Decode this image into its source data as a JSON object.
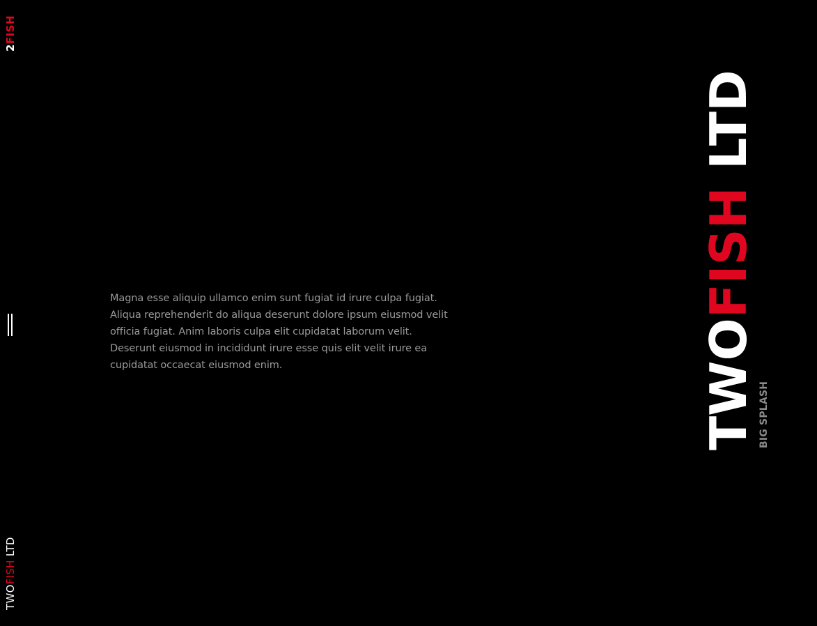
{
  "logo_small": {
    "part1": "2",
    "part2": "FISH"
  },
  "menu": {
    "label": ""
  },
  "brand_bottom": {
    "part1": "TWO",
    "part2": "FISH",
    "part3": " LTD"
  },
  "intro_text": "Magna esse aliquip ullamco enim sunt fugiat id irure culpa fugiat. Aliqua reprehenderit do aliqua deserunt dolore ipsum eiusmod velit officia fugiat. Anim laboris culpa elit cupidatat laborum velit. Deserunt eiusmod in incididunt irure esse quis elit velit irure ea cupidatat occaecat eiusmod enim.",
  "hero": {
    "title_part1": "TWO",
    "title_part2": "FISH",
    "title_part3": " LTD",
    "subtitle": "BIG SPLASH"
  },
  "colors": {
    "background": "#000000",
    "accent": "#e0061f",
    "text": "#ffffff",
    "muted": "#9a9a9a"
  }
}
